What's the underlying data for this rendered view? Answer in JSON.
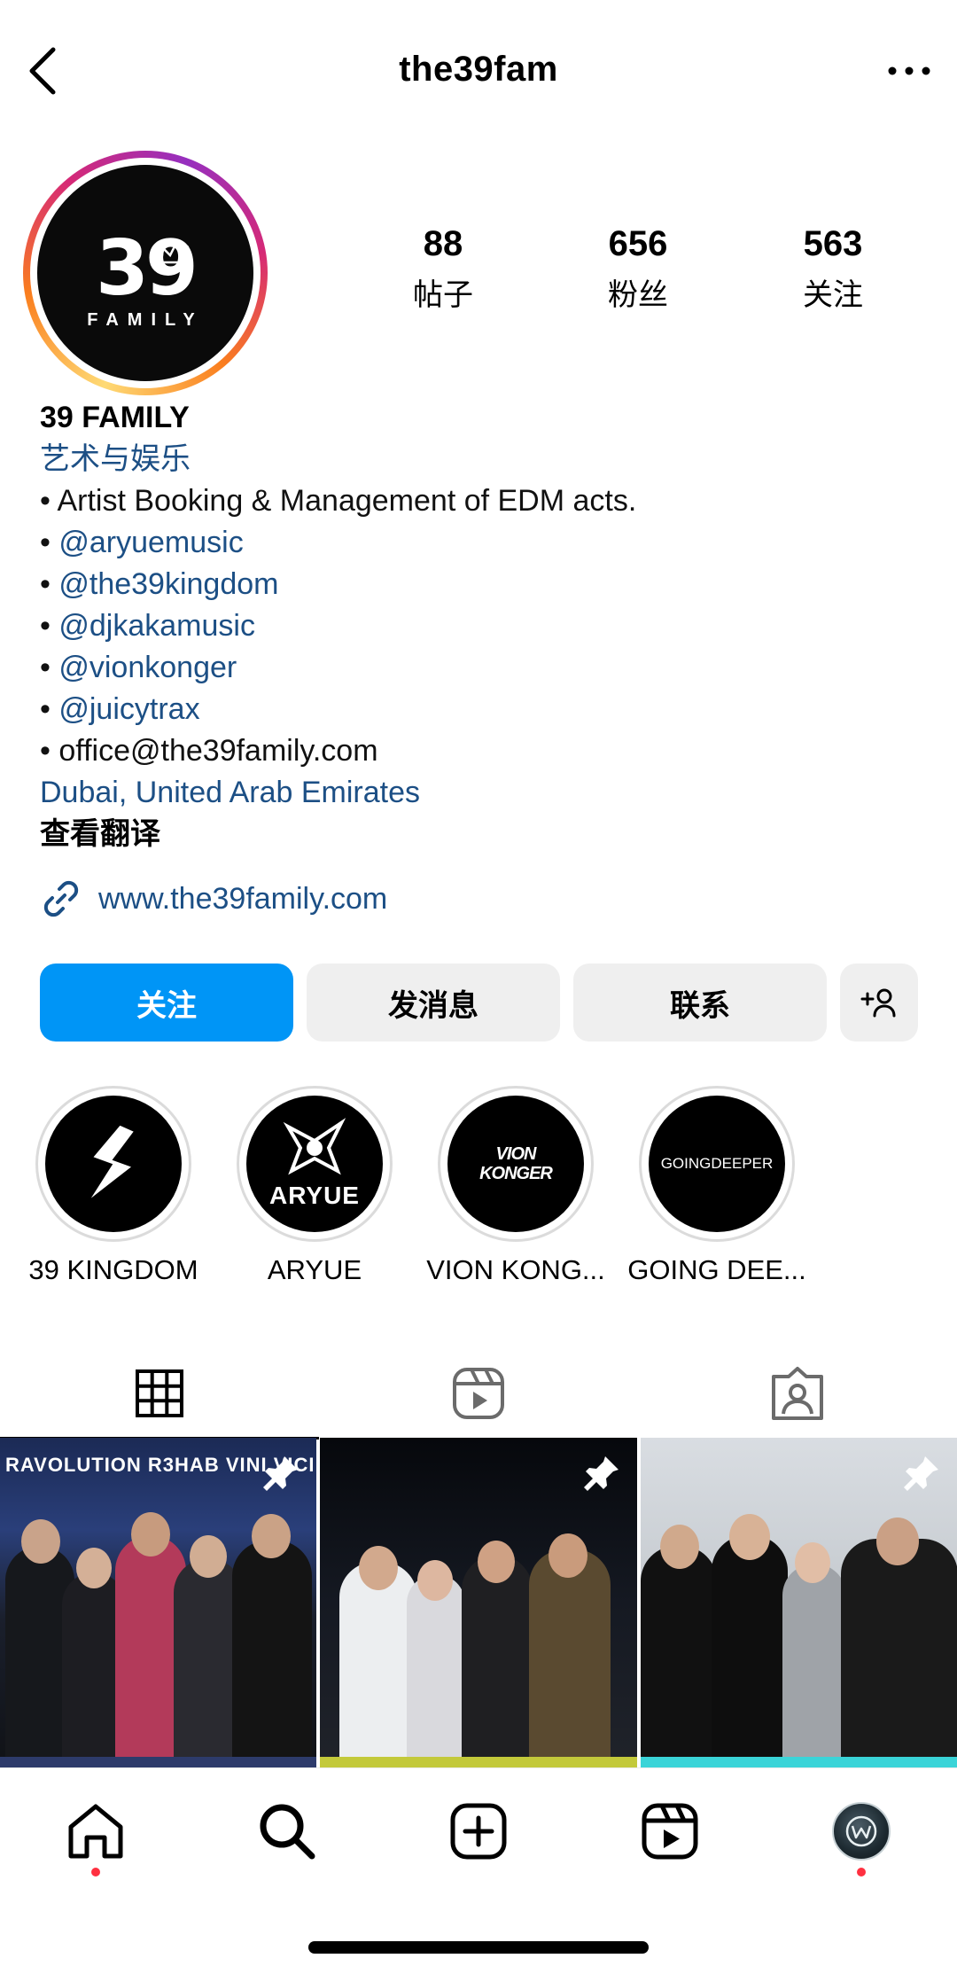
{
  "header": {
    "username": "the39fam"
  },
  "avatar": {
    "logo_text": "39",
    "logo_sub": "FAMILY"
  },
  "stats": [
    {
      "value": "88",
      "label": "帖子"
    },
    {
      "value": "656",
      "label": "粉丝"
    },
    {
      "value": "563",
      "label": "关注"
    }
  ],
  "bio": {
    "name": "39 FAMILY",
    "category": "艺术与娱乐",
    "line1": "• Artist Booking & Management of EDM acts.",
    "mention_prefix": "• ",
    "mentions": [
      "@aryuemusic",
      "@the39kingdom",
      "@djkakamusic",
      "@vionkonger",
      "@juicytrax"
    ],
    "email_line": "• office@the39family.com",
    "location": "Dubai, United Arab Emirates",
    "translate": "查看翻译"
  },
  "link": {
    "url": "www.the39family.com"
  },
  "buttons": {
    "follow": "关注",
    "message": "发消息",
    "contact": "联系"
  },
  "highlights": [
    {
      "label": "39 KINGDOM",
      "logo": "39K"
    },
    {
      "label": "ARYUE",
      "logo": "ARYUE"
    },
    {
      "label": "VION KONG...",
      "logo": "VION KONGER"
    },
    {
      "label": "GOING DEE...",
      "logo": "GOINGDEEPER"
    }
  ],
  "posts": [
    {
      "banner": "RAVOLUTION   R3HAB   VINI  VICI"
    },
    {
      "banner": ""
    },
    {
      "banner": ""
    }
  ],
  "colors": {
    "accent": "#0095f6",
    "link": "#1c4f85",
    "notification": "#ff3040"
  },
  "icons": {
    "back": "chevron-left-icon",
    "more": "more-horizontal-icon",
    "link": "link-icon",
    "add_person": "add-person-icon",
    "grid": "grid-icon",
    "reels": "reels-icon",
    "tagged": "tagged-icon",
    "pin": "pin-icon",
    "home": "home-icon",
    "search": "search-icon",
    "create": "create-icon"
  }
}
